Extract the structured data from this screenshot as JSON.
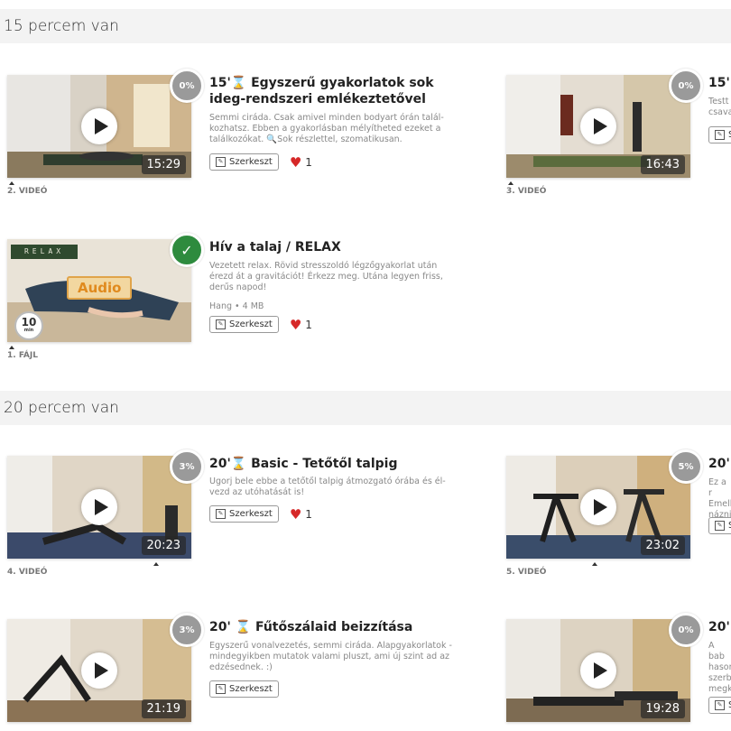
{
  "sections": [
    {
      "title": "15 percem van"
    },
    {
      "title": "20 percem van"
    }
  ],
  "cards": [
    {
      "progress": "0%",
      "duration": "15:29",
      "label": "2. VIDEÓ",
      "title": "15' Egyszerű gyakorlatok sok ideg-rendszeri emlékeztetővel",
      "title_prefix": "15'",
      "title_rest": "Egyszerű gyakorlatok sok ideg-rendszeri emlékeztetővel",
      "desc": "Semmi ciráda. Csak amivel minden bodyart órán talál-kozhatsz. Ebben a gyakorlásban mélyítheted ezeket a találkozókat. 🔍Sok részlettel, szomatikusan.",
      "edit": "Szerkeszt",
      "likes": "1"
    },
    {
      "progress": "0%",
      "duration": "16:43",
      "label": "3. VIDEÓ",
      "title_prefix": "15'",
      "title_rest": "",
      "desc": "Testt csava",
      "edit": "S"
    },
    {
      "progress": "✓",
      "label": "1. FÁJL",
      "relax": "RELAX",
      "audio": "Audio",
      "timer": "10",
      "timer_unit": "min",
      "title": "Hív a talaj / RELAX",
      "desc": "Vezetett relax. Rövid stresszoldó légzőgyakorlat után érezd át a gravitációt! Érkezz meg. Utána legyen friss, derűs napod!",
      "meta": "Hang • 4 MB",
      "edit": "Szerkeszt",
      "likes": "1"
    },
    {
      "progress": "3%",
      "duration": "20:23",
      "label": "4. VIDEÓ",
      "title_prefix": "20'",
      "title_rest": "Basic - Tetőtől talpig",
      "desc": "Ugorj bele ebbe a tetőtől talpig átmozgató órába és él-vezd az utóhatását is!",
      "edit": "Szerkeszt",
      "likes": "1"
    },
    {
      "progress": "5%",
      "duration": "23:02",
      "label": "5. VIDEÓ",
      "title_prefix": "20'",
      "title_rest": "",
      "desc": "Ez a r Emell názni",
      "edit": "S"
    },
    {
      "progress": "3%",
      "duration": "21:19",
      "label": "",
      "title_prefix": "20'",
      "title_rest": "Fűtőszálaid beizzítása",
      "desc": "Egyszerű vonalvezetés, semmi ciráda. Alapgyakorlatok - mindegyikben mutatok valami pluszt, ami új szint ad az edzésednek. :)",
      "edit": "Szerkeszt"
    },
    {
      "progress": "0%",
      "duration": "19:28",
      "label": "",
      "title_prefix": "20'",
      "title_rest": "",
      "desc": "A bab hason szerb megk",
      "edit": "S"
    }
  ],
  "colors": {
    "header_bg": "#f3f3f3",
    "badge_grey": "#9a9a9a",
    "badge_done": "#2e8b3e",
    "heart": "#d62828",
    "hourglass": "#d38b1e"
  },
  "icons": [
    "play-icon",
    "hourglass-icon",
    "heart-icon",
    "edit-icon",
    "check-icon",
    "search-icon",
    "timer-icon"
  ]
}
